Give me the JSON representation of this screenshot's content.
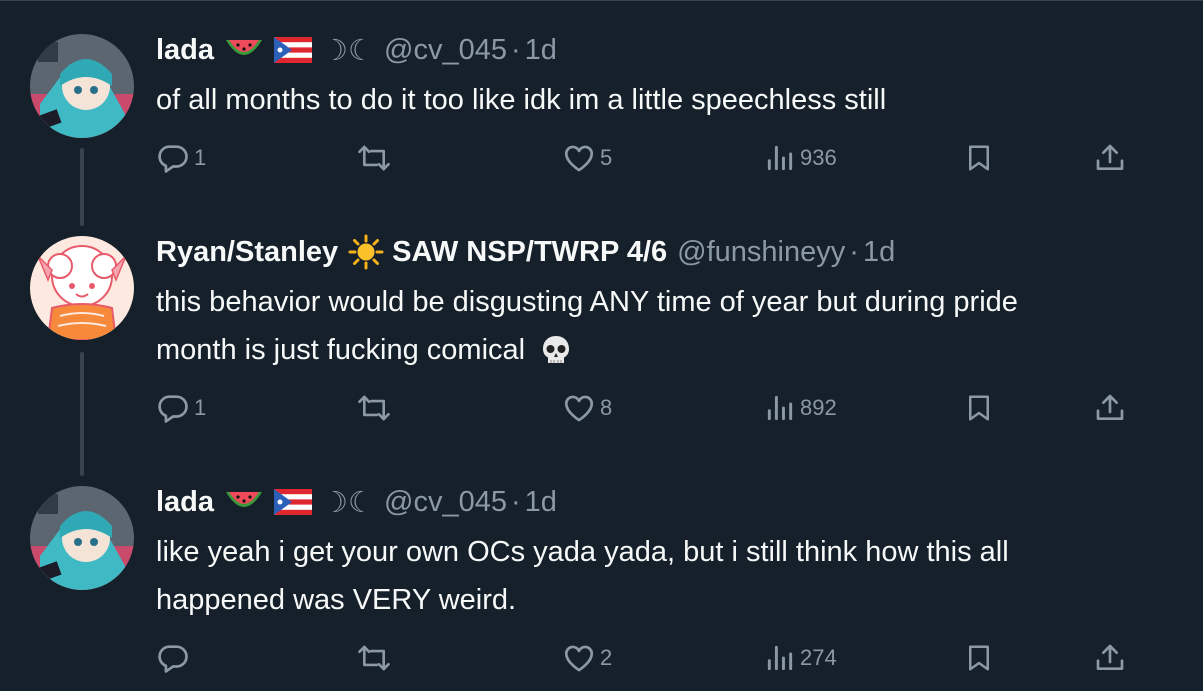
{
  "tweets": [
    {
      "name": "lada",
      "moon": "☽☾",
      "handle": "@cv_045",
      "dot": "·",
      "time": "1d",
      "body": "of all months to do it too like idk im a little speechless still",
      "reply_count": "1",
      "like_count": "5",
      "view_count": "936"
    },
    {
      "name": "Ryan/Stanley",
      "name2": "SAW NSP/TWRP 4/6",
      "handle": "@funshineyy",
      "dot": "·",
      "time": "1d",
      "body_line1": "this behavior would be disgusting ANY time of year but during pride",
      "body_line2": "month is just fucking comical",
      "reply_count": "1",
      "like_count": "8",
      "view_count": "892"
    },
    {
      "name": "lada",
      "moon": "☽☾",
      "handle": "@cv_045",
      "dot": "·",
      "time": "1d",
      "body_line1": "like yeah i get your own OCs yada yada, but i still think how this all",
      "body_line2": "happened was VERY weird.",
      "like_count": "2",
      "view_count": "274"
    }
  ],
  "icons": [
    "reply-icon",
    "retweet-icon",
    "like-icon",
    "views-icon",
    "bookmark-icon",
    "share-icon",
    "watermelon-icon",
    "puerto-rico-flag-icon",
    "sun-icon",
    "skull-icon"
  ],
  "colors": {
    "background": "#15202b",
    "text": "#f7f9f9",
    "muted": "#8b98a5",
    "divider": "#38444d"
  }
}
